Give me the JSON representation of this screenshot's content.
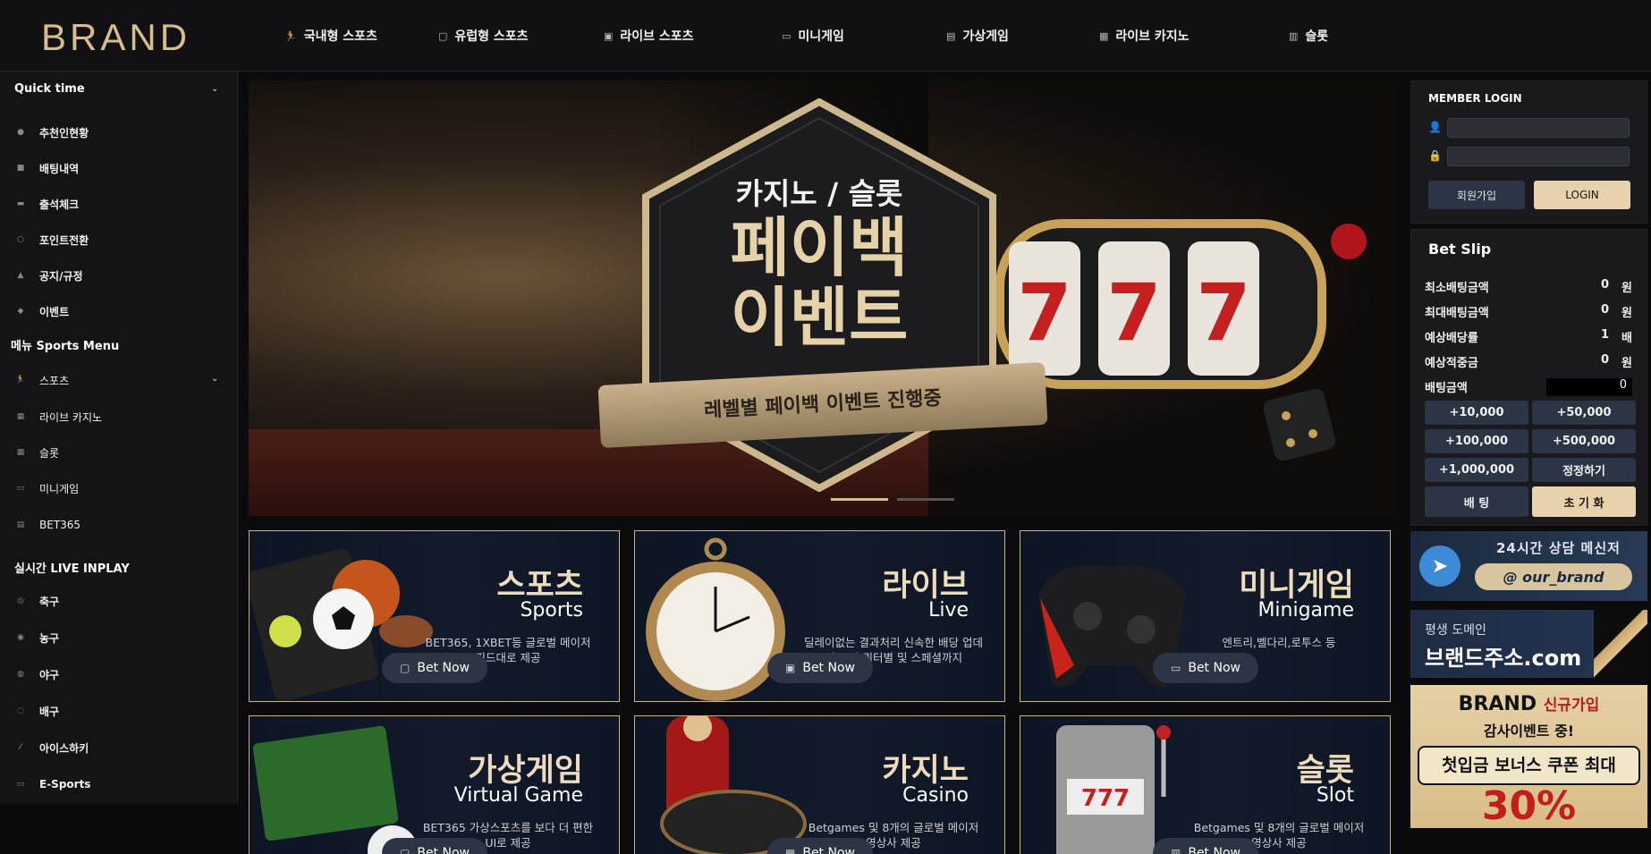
{
  "header": {
    "logo": "BRAND",
    "nav": [
      {
        "label": "국내형 스포츠",
        "icon": "running-icon"
      },
      {
        "label": "유럽형 스포츠",
        "icon": "square-icon"
      },
      {
        "label": "라이브 스포츠",
        "icon": "camera-icon"
      },
      {
        "label": "미니게임",
        "icon": "gamepad-icon"
      },
      {
        "label": "가상게임",
        "icon": "device-icon"
      },
      {
        "label": "라이브 카지노",
        "icon": "cards-icon"
      },
      {
        "label": "슬롯",
        "icon": "slot-icon"
      }
    ]
  },
  "sidebar": {
    "quick": {
      "title": "Quick time",
      "items": [
        "추천인현황",
        "배팅내역",
        "출석체크",
        "포인트전환",
        "공지/규정",
        "이벤트"
      ]
    },
    "sports": {
      "title": "메뉴 Sports Menu",
      "items": [
        "스포츠",
        "라이브 카지노",
        "슬롯",
        "미니게임",
        "BET365"
      ]
    },
    "live": {
      "title": "실시간 LIVE INPLAY",
      "items": [
        "축구",
        "농구",
        "야구",
        "배구",
        "아이스하키",
        "E-Sports"
      ]
    }
  },
  "banner": {
    "line1": "카지노 / 슬롯",
    "line2": "페이백",
    "line3": "이벤트",
    "ribbon": "레벨별 페이백 이벤트 진행중",
    "slides": 2,
    "active_slide": 0
  },
  "cards": [
    {
      "title_ko": "스포츠",
      "title_en": "Sports",
      "desc": "BET365, 1XBET등 글로벌 메이저 피드대로 제공",
      "button": "Bet Now",
      "icon": "tablet-icon"
    },
    {
      "title_ko": "라이브",
      "title_en": "Live",
      "desc": "딜레이없는 결과처리 신속한 배당 업데이트 별 쿼터별 및 스페셜까지",
      "button": "Bet Now",
      "icon": "camera-icon"
    },
    {
      "title_ko": "미니게임",
      "title_en": "Minigame",
      "desc": "엔트리,벨다리,로투스 등",
      "button": "Bet Now",
      "icon": "gamepad-icon"
    },
    {
      "title_ko": "가상게임",
      "title_en": "Virtual Game",
      "desc": "BET365 가상스포츠를 보다 더 편한 UI로 제공",
      "button": "Bet Now",
      "icon": "tablet-icon"
    },
    {
      "title_ko": "카지노",
      "title_en": "Casino",
      "desc": "Betgames 및 8개의 글로벌 메이저 영상사 제공",
      "button": "Bet Now",
      "icon": "cards-icon"
    },
    {
      "title_ko": "슬롯",
      "title_en": "Slot",
      "desc": "Betgames 및 8개의 글로벌 메이저 영상사 제공",
      "button": "Bet Now",
      "icon": "slot-icon"
    }
  ],
  "login": {
    "title": "MEMBER LOGIN",
    "id_placeholder": "",
    "pw_placeholder": "",
    "join": "회원가입",
    "login": "LOGIN"
  },
  "betslip": {
    "title": "Bet Slip",
    "rows": [
      {
        "label": "최소배팅금액",
        "value": "0",
        "unit": "원"
      },
      {
        "label": "최대배팅금액",
        "value": "0",
        "unit": "원"
      },
      {
        "label": "예상배당률",
        "value": "1",
        "unit": "배"
      },
      {
        "label": "예상적중금",
        "value": "0",
        "unit": "원"
      }
    ],
    "amount_label": "배팅금액",
    "amount_value": "0",
    "buttons": [
      "+10,000",
      "+50,000",
      "+100,000",
      "+500,000",
      "+1,000,000",
      "정정하기"
    ],
    "bet": "배 팅",
    "reset": "초 기 화"
  },
  "promos": {
    "telegram": {
      "line1": "24시간 상담 메신저",
      "line2": "@ our_brand"
    },
    "domain": {
      "line1": "평생 도메인",
      "line2": "브랜드주소.com"
    },
    "event": {
      "brand": "BRAND",
      "tag": "신규가입",
      "line2": "감사이벤트 중!",
      "line3": "첫입금 보너스 쿠폰 최대",
      "line4": "30%"
    }
  },
  "colors": {
    "gold": "#d8bc8c",
    "accent_button": "#e8d1ad",
    "panel": "#1a1a1e",
    "nav_bg": "#111114"
  }
}
